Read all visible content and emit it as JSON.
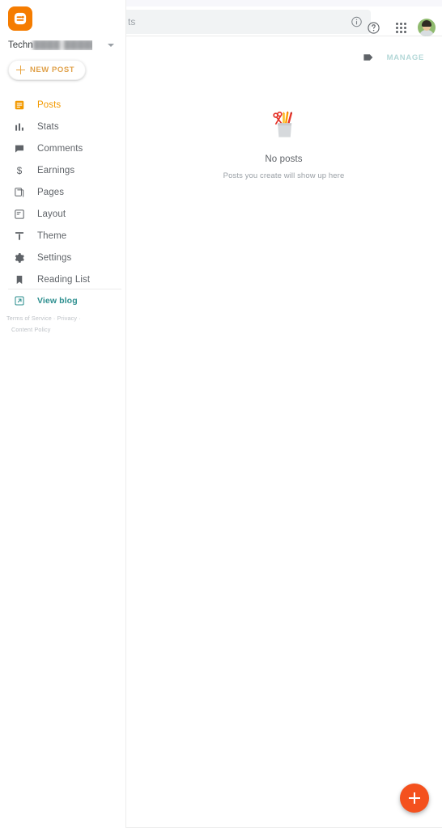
{
  "app": {
    "name": "Blogger",
    "logo_icon": "blogger-logo-icon",
    "accent_orange": "#f57c00",
    "accent_teal": "#2d8f8f",
    "fab_color": "#f4511e"
  },
  "header": {
    "search_value": "ts",
    "search_placeholder": "",
    "info_icon": "info-icon",
    "help_icon": "help-icon",
    "apps_icon": "apps-grid-icon",
    "avatar_icon": "user-avatar"
  },
  "sidebar": {
    "blog_name_visible": "Techn",
    "blog_name_redacted": "████  █████",
    "dropdown_icon": "chevron-down-icon",
    "new_post_label": "NEW POST",
    "new_post_icon": "plus-icon",
    "items": [
      {
        "label": "Posts",
        "icon": "posts-icon",
        "active": true
      },
      {
        "label": "Stats",
        "icon": "stats-icon",
        "active": false
      },
      {
        "label": "Comments",
        "icon": "comments-icon",
        "active": false
      },
      {
        "label": "Earnings",
        "icon": "earnings-icon",
        "active": false
      },
      {
        "label": "Pages",
        "icon": "pages-icon",
        "active": false
      },
      {
        "label": "Layout",
        "icon": "layout-icon",
        "active": false
      },
      {
        "label": "Theme",
        "icon": "theme-icon",
        "active": false
      },
      {
        "label": "Settings",
        "icon": "settings-icon",
        "active": false
      },
      {
        "label": "Reading List",
        "icon": "reading-list-icon",
        "active": false
      }
    ],
    "view_blog_label": "View blog",
    "view_blog_icon": "external-link-icon",
    "legal": {
      "terms": "Terms of Service",
      "sep1": "·",
      "privacy": "Privacy",
      "sep2": "·",
      "content_policy": "Content Policy"
    }
  },
  "main": {
    "manage_label": "MANAGE",
    "label_icon": "label-tag-icon",
    "empty_state": {
      "illustration": "pencil-cup-illustration",
      "title": "No posts",
      "subtitle": "Posts you create will show up here"
    },
    "fab_icon": "plus-icon",
    "fab_label": "New post"
  }
}
